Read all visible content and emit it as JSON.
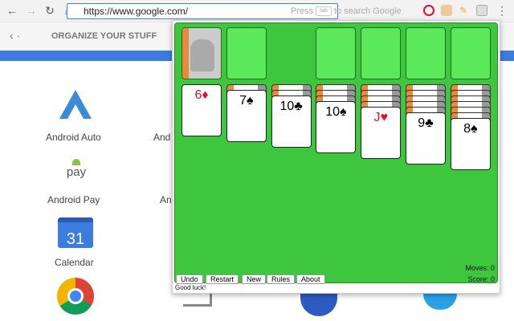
{
  "browser": {
    "url": "https://www.google.com/",
    "hint_pre": "Press",
    "hint_key": "tab",
    "hint_post": "to search Google"
  },
  "page": {
    "header": "ORGANIZE YOUR STUFF",
    "apps": [
      {
        "label": "Android Auto"
      },
      {
        "label": "And"
      },
      {
        "label": "Android Pay"
      },
      {
        "label": "An"
      },
      {
        "label": "Calendar"
      }
    ],
    "pay_text": "pay",
    "calendar_day": "31"
  },
  "game": {
    "tableau": [
      {
        "down": 0,
        "card": "6♦",
        "red": true
      },
      {
        "down": 1,
        "card": "7♠",
        "red": false
      },
      {
        "down": 2,
        "card": "10♣",
        "red": false
      },
      {
        "down": 3,
        "card": "10♠",
        "red": false
      },
      {
        "down": 4,
        "card": "J♥",
        "red": true
      },
      {
        "down": 5,
        "card": "9♣",
        "red": false
      },
      {
        "down": 6,
        "card": "8♠",
        "red": false
      }
    ],
    "buttons": [
      "Undo",
      "Restart",
      "New",
      "Rules",
      "About"
    ],
    "moves": "Moves: 0",
    "score": "Score: 0",
    "status": "Good luck!"
  }
}
